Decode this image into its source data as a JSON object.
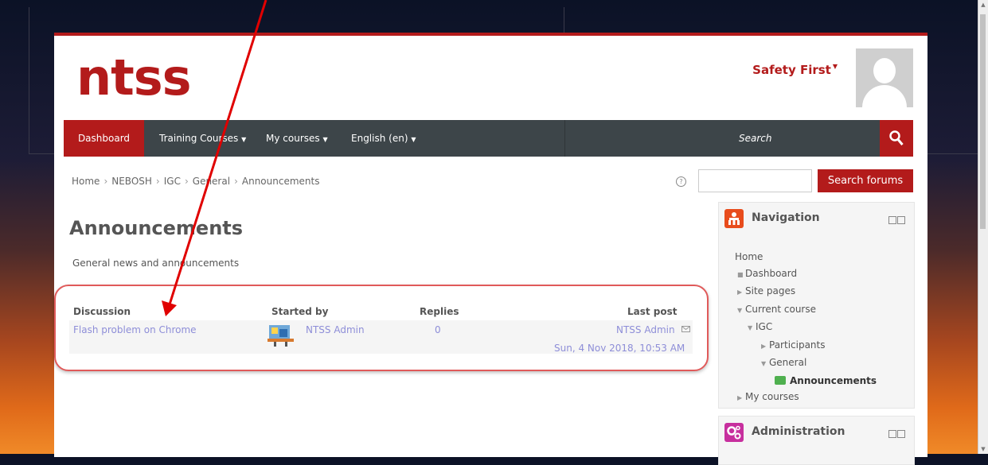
{
  "brand": {
    "logo": "ntss"
  },
  "user_menu": {
    "label": "Safety First"
  },
  "navbar": {
    "items": [
      "Dashboard",
      "Training Courses",
      "My courses",
      "English (en)"
    ],
    "search_placeholder": "Search"
  },
  "breadcrumb": [
    "Home",
    "NEBOSH",
    "IGC",
    "General",
    "Announcements"
  ],
  "forum_search": {
    "button": "Search forums"
  },
  "page": {
    "title": "Announcements",
    "description": "General news and announcements"
  },
  "table": {
    "headers": {
      "discussion": "Discussion",
      "started_by": "Started by",
      "replies": "Replies",
      "last_post": "Last post"
    },
    "rows": [
      {
        "discussion": "Flash problem on Chrome",
        "started_by": "NTSS Admin",
        "replies": "0",
        "last_post_user": "NTSS Admin",
        "last_post_date": "Sun, 4 Nov 2018, 10:53 AM"
      }
    ]
  },
  "navigation_block": {
    "title": "Navigation",
    "items": {
      "home": "Home",
      "dashboard": "Dashboard",
      "site_pages": "Site pages",
      "current_course": "Current course",
      "igc": "IGC",
      "participants": "Participants",
      "general": "General",
      "announcements": "Announcements",
      "my_courses": "My courses"
    }
  },
  "administration_block": {
    "title": "Administration"
  },
  "colors": {
    "brand_red": "#b31b1b",
    "nav_dark": "#3d4549",
    "link": "#8e8ed8",
    "annotation_red": "#e00000"
  }
}
